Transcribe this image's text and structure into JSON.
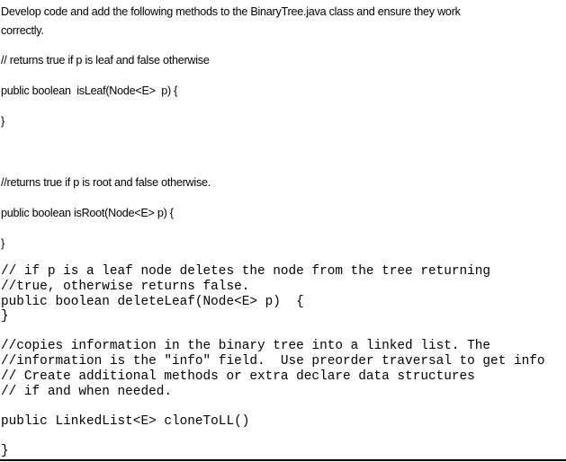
{
  "document": {
    "intro": [
      "Develop code and add the following methods to the BinaryTree.java class and ensure they work",
      "correctly."
    ],
    "is_leaf": {
      "comment": "// returns true if p is leaf and false otherwise",
      "signature": "public boolean  isLeaf(Node<E>  p) {",
      "close": "}"
    },
    "is_root": {
      "comment": "//returns true if p is root and false otherwise.",
      "signature": "public boolean isRoot(Node<E> p) {",
      "close": "}"
    },
    "delete_leaf": {
      "comment_lines": [
        "// if p is a leaf node deletes the node from the tree returning",
        "//true, otherwise returns false."
      ],
      "signature": "public boolean deleteLeaf(Node<E> p)  {",
      "close": "}"
    },
    "clone_to_ll": {
      "comment_lines": [
        "//copies information in the binary tree into a linked list. The",
        "//information is the \"info\" field.  Use preorder traversal to get info",
        "// Create additional methods or extra declare data structures",
        "// if and when needed."
      ],
      "signature": "public LinkedList<E> cloneToLL()",
      "close": "}"
    }
  }
}
